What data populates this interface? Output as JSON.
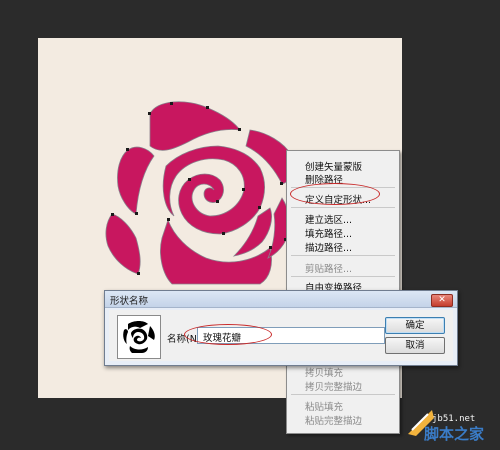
{
  "context_menu": {
    "items": [
      {
        "label": "创建矢量蒙版",
        "enabled": true
      },
      {
        "label": "删除路径",
        "enabled": true
      },
      {
        "label": "定义自定形状...",
        "enabled": true,
        "highlighted": true
      },
      {
        "label": "建立选区...",
        "enabled": true
      },
      {
        "label": "填充路径...",
        "enabled": true
      },
      {
        "label": "描边路径...",
        "enabled": true
      },
      {
        "label": "剪贴路径...",
        "enabled": false
      },
      {
        "label": "自由变换路径",
        "enabled": true
      },
      {
        "label": "拷贝填充",
        "enabled": false
      },
      {
        "label": "拷贝完整描边",
        "enabled": false
      },
      {
        "label": "粘贴填充",
        "enabled": false
      },
      {
        "label": "粘贴完整描边",
        "enabled": false
      }
    ]
  },
  "dialog": {
    "title": "形状名称",
    "close_label": "✕",
    "name_label": "名称(N):",
    "name_value": "玫瑰花瓣",
    "ok_label": "确定",
    "cancel_label": "取消"
  },
  "watermark": {
    "site": "jb51.net",
    "name": "脚本之家"
  },
  "colors": {
    "rose": "#c8175f",
    "highlight": "#c92b2b",
    "canvas": "#f3ebe1"
  }
}
